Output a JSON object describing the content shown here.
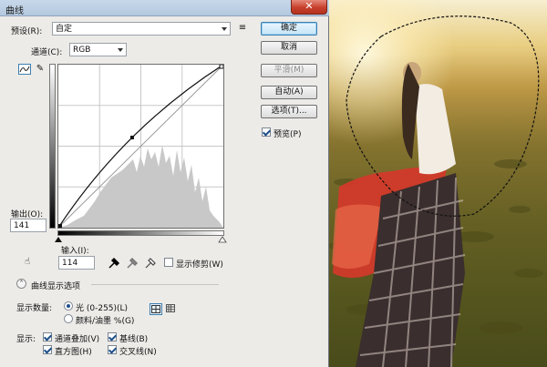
{
  "dialog": {
    "title": "曲线",
    "close_glyph": "✕"
  },
  "preset": {
    "label": "预设(R):",
    "value": "自定"
  },
  "channel": {
    "label": "通道(C):",
    "value": "RGB"
  },
  "buttons": {
    "ok": "确定",
    "cancel": "取消",
    "smooth": "平滑(M)",
    "auto": "自动(A)",
    "options": "选项(T)..."
  },
  "preview": {
    "label": "预览(P)",
    "checked": true
  },
  "output": {
    "label": "输出(O):",
    "value": "141"
  },
  "input": {
    "label": "输入(I):",
    "value": "114"
  },
  "show_clipping": {
    "label": "显示修剪(W)",
    "checked": false
  },
  "curve_display_options": {
    "label": "曲线显示选项"
  },
  "show_amount": {
    "label": "显示数量:",
    "option_light": "光 (0-255)(L)",
    "option_pigment": "颜料/油墨 %(G)",
    "selected": "light"
  },
  "show": {
    "label": "显示:",
    "channel_overlays": "通道叠加(V)",
    "baseline": "基线(B)",
    "histogram": "直方图(H)",
    "intersection_line": "交叉线(N)"
  },
  "curve": {
    "input_levels": [
      0,
      114,
      255
    ],
    "output_levels": [
      0,
      141,
      255
    ]
  },
  "icons": {
    "curve_tool": "curve-icon",
    "pencil_tool": "pencil-icon",
    "presets_menu": "list-icon",
    "hand_adjust": "hand-icon",
    "eyedroppers": [
      "black-eyedropper-icon",
      "gray-eyedropper-icon",
      "white-eyedropper-icon"
    ],
    "expand": "chevron-up-icon",
    "grid_4": "grid-4-icon",
    "grid_10": "grid-10-icon"
  }
}
